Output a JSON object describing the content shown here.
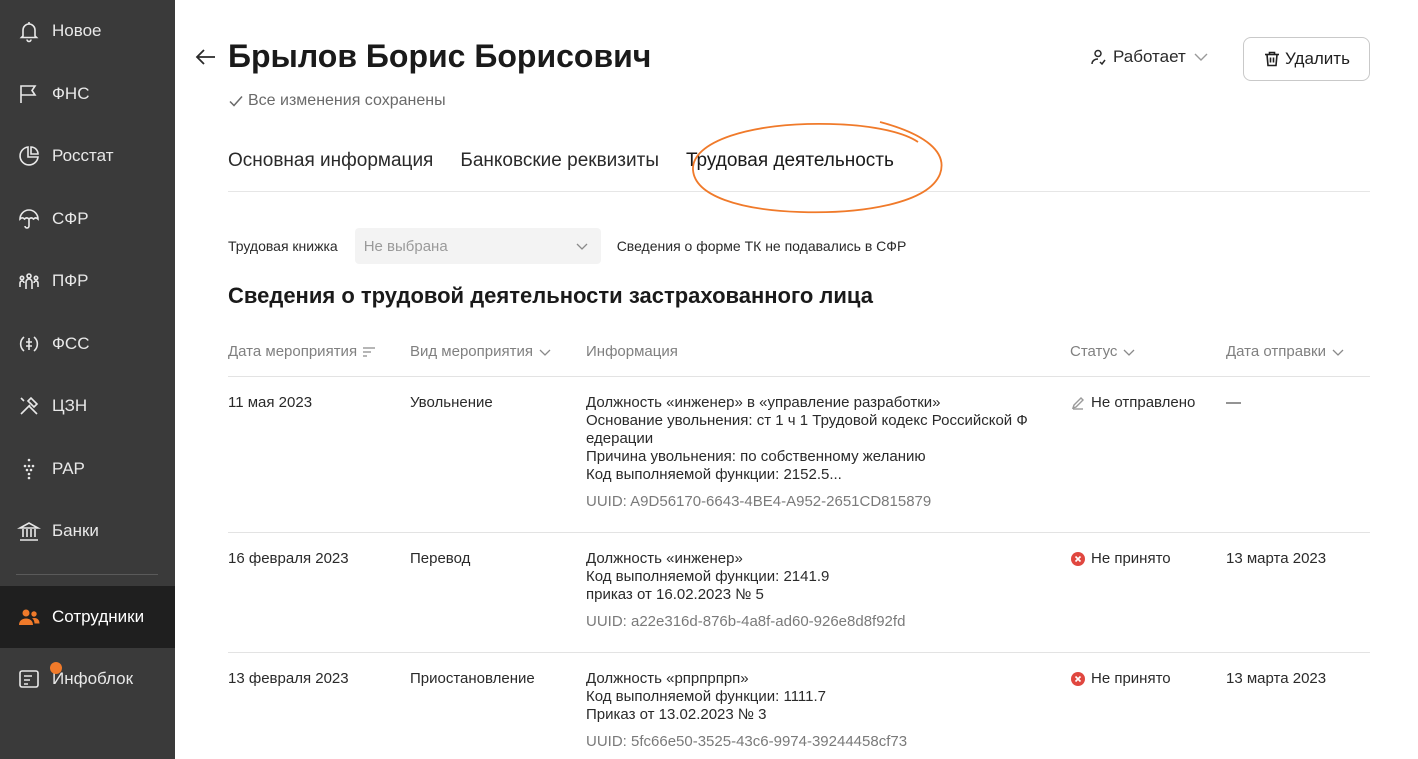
{
  "sidebar": {
    "items": [
      {
        "label": "Новое",
        "icon": "bell-icon"
      },
      {
        "label": "ФНС",
        "icon": "flag-icon"
      },
      {
        "label": "Росстат",
        "icon": "chart-pie-icon"
      },
      {
        "label": "СФР",
        "icon": "umbrella-icon"
      },
      {
        "label": "ПФР",
        "icon": "people-group-icon"
      },
      {
        "label": "ФСС",
        "icon": "shield-circle-icon"
      },
      {
        "label": "ЦЗН",
        "icon": "tools-icon"
      },
      {
        "label": "РАР",
        "icon": "grapes-icon"
      },
      {
        "label": "Банки",
        "icon": "bank-icon"
      },
      {
        "label": "Сотрудники",
        "icon": "employees-icon",
        "active": true
      },
      {
        "label": "Инфоблок",
        "icon": "infoblock-icon",
        "badge": true
      }
    ]
  },
  "header": {
    "title": "Брылов Борис Борисович",
    "saved_status": "Все изменения сохранены",
    "employment_status": "Работает",
    "delete_label": "Удалить"
  },
  "tabs": [
    {
      "label": "Основная информация"
    },
    {
      "label": "Банковские реквизиты"
    },
    {
      "label": "Трудовая деятельность",
      "active": true
    }
  ],
  "work_book": {
    "label": "Трудовая книжка",
    "placeholder": "Не выбрана",
    "note": "Сведения о форме ТК не подавались в СФР"
  },
  "section_title": "Сведения о трудовой деятельности застрахованного лица",
  "table": {
    "headers": {
      "date": "Дата мероприятия",
      "type": "Вид мероприятия",
      "info": "Информация",
      "status": "Статус",
      "sent": "Дата отправки"
    },
    "rows": [
      {
        "date": "11 мая 2023",
        "type": "Увольнение",
        "info": [
          "Должность «инженер» в «управление разработки»",
          "Основание увольнения: ст 1 ч 1 Трудовой кодекс Российской Ф",
          "едерации",
          "Причина увольнения: по собственному желанию",
          "Код выполняемой функции: 2152.5..."
        ],
        "uuid": "UUID: A9D56170-6643-4BE4-A952-2651CD815879",
        "status": "Не отправлено",
        "status_kind": "draft",
        "sent": "—"
      },
      {
        "date": "16 февраля 2023",
        "type": "Перевод",
        "info": [
          "Должность «инженер»",
          "Код выполняемой функции: 2141.9",
          "приказ от 16.02.2023 № 5"
        ],
        "uuid": "UUID: a22e316d-876b-4a8f-ad60-926e8d8f92fd",
        "status": "Не принято",
        "status_kind": "rejected",
        "sent": "13 марта 2023"
      },
      {
        "date": "13 февраля 2023",
        "type": "Приостановление",
        "info": [
          "Должность «рпрпрпрп»",
          "Код выполняемой функции: 1111.7",
          "Приказ от 13.02.2023 № 3"
        ],
        "uuid": "UUID: 5fc66e50-3525-43c6-9974-39244458cf73",
        "status": "Не принято",
        "status_kind": "rejected",
        "sent": "13 марта 2023"
      }
    ]
  },
  "colors": {
    "sidebar_bg": "#3a3a3a",
    "sidebar_active_bg": "#1f1f1f",
    "accent_orange": "#f07a2a",
    "rejected_red": "#e0473f"
  }
}
